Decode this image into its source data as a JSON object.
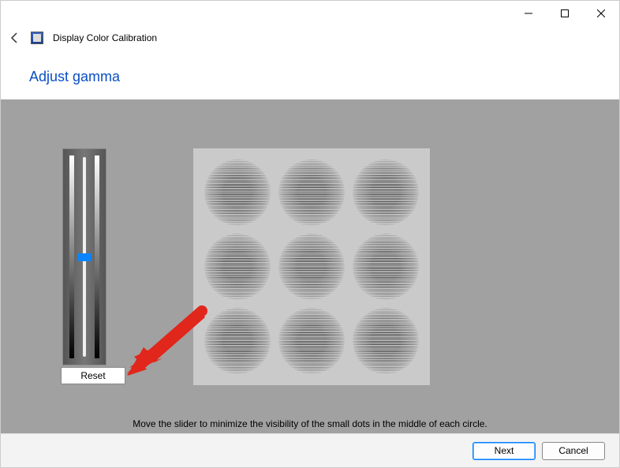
{
  "window": {
    "app_title": "Display Color Calibration"
  },
  "heading": "Adjust gamma",
  "controls": {
    "reset_label": "Reset",
    "slider_value": 50
  },
  "instruction": "Move the slider to minimize the visibility of the small dots in the middle of each circle.",
  "footer": {
    "next_label": "Next",
    "cancel_label": "Cancel"
  }
}
